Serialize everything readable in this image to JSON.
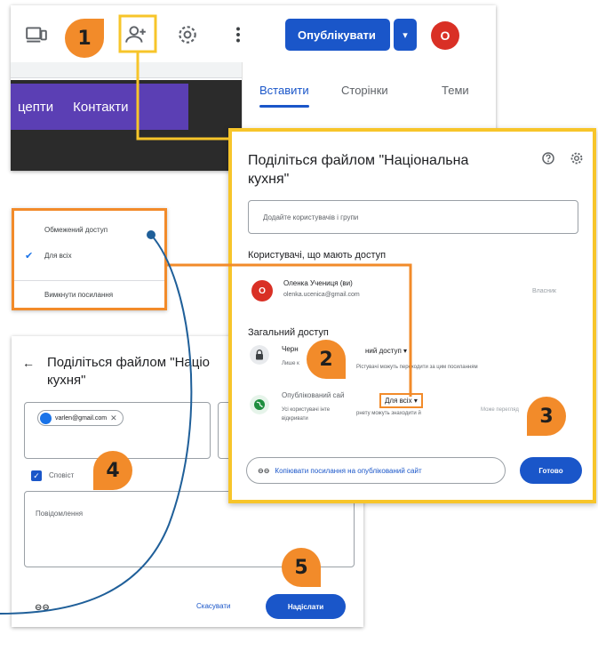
{
  "toolbar": {
    "publish_label": "Опублікувати",
    "avatar_letter": "O"
  },
  "site": {
    "nav_items": [
      "цепти",
      "Контакти"
    ]
  },
  "side_panel": {
    "tabs": [
      "Вставити",
      "Сторінки",
      "Теми"
    ]
  },
  "access_menu": {
    "items": [
      "Обмежений доступ",
      "Для всіх",
      "Вимкнути посилання"
    ],
    "selected": "Для всіх"
  },
  "share_dialog": {
    "title": "Поділіться файлом \"Національна кухня\"",
    "add_users_placeholder": "Додайте користувачів і групи",
    "users_heading": "Користувачі, що мають доступ",
    "owner": {
      "avatar_letter": "O",
      "name": "Оленка Учениця (ви)",
      "email": "olenka.ucenica@gmail.com",
      "role": "Власник"
    },
    "general_access_heading": "Загальний доступ",
    "draft_title_visible": "Черн",
    "draft_access_value": "ний доступ",
    "draft_desc": "Лише к",
    "draft_desc_rest": "Рістувачі можуть переходити за цим посиланням",
    "published_title": "Опублікований сай",
    "published_desc": "Усі користувачі інте",
    "published_desc_rest": "рнету можуть знаходити й",
    "published_desc_line2": "відкривати",
    "published_value": "Для всіх",
    "published_role": "Може перегляд",
    "copy_link_label": "Копіювати посилання на опублікований сайт",
    "done_label": "Готово"
  },
  "send_dialog": {
    "title": "Поділіться файлом \"Націо",
    "title_line2": "кухня\"",
    "chip_email": "varlen@gmail.com",
    "notify_label": "Сповіст",
    "message_placeholder": "Повідомлення",
    "cancel_label": "Скасувати",
    "send_label": "Надіслати"
  },
  "steps": [
    "1",
    "2",
    "3",
    "4",
    "5"
  ],
  "colors": {
    "accent_blue": "#1a56c9",
    "step_orange": "#f28b2a",
    "highlight_yellow": "#f7c52a",
    "connector_blue": "#1f5f99",
    "avatar_red": "#d93025"
  },
  "icons": {
    "toolbar": [
      "preview-devices-icon",
      "add-person-icon",
      "settings-icon",
      "more-vert-icon"
    ],
    "dialog": [
      "help-icon",
      "gear-icon",
      "lock-icon",
      "globe-icon",
      "link-icon"
    ]
  }
}
